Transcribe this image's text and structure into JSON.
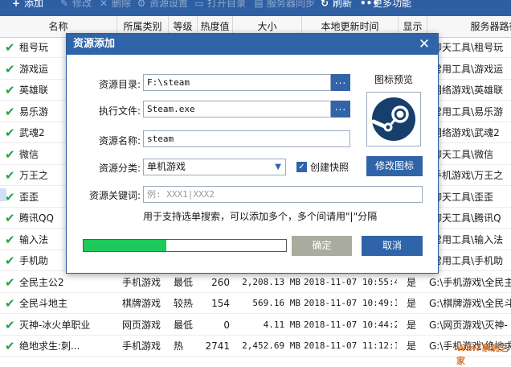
{
  "toolbar": {
    "items": [
      "添加",
      "修改",
      "删除",
      "资源设置",
      "打开目录",
      "服务器同步",
      "刷新",
      "更多功能"
    ]
  },
  "table": {
    "columns": [
      "名称",
      "所属类别",
      "等级",
      "热度值",
      "大小",
      "本地更新时间",
      "显示",
      "服务器路径"
    ],
    "rows": [
      {
        "name": "租号玩",
        "category": "",
        "level": "",
        "heat": "",
        "size": "",
        "time": "",
        "show": "",
        "path": "\\聊天工具\\租号玩"
      },
      {
        "name": "游戏运",
        "category": "",
        "level": "",
        "heat": "",
        "size": "",
        "time": "",
        "show": "",
        "path": "\\常用工具\\游戏运"
      },
      {
        "name": "英雄联",
        "category": "",
        "level": "",
        "heat": "",
        "size": "",
        "time": "",
        "show": "",
        "path": "\\网络游戏\\英雄联"
      },
      {
        "name": "易乐游",
        "category": "",
        "level": "",
        "heat": "",
        "size": "",
        "time": "",
        "show": "",
        "path": "\\常用工具\\易乐游"
      },
      {
        "name": "武魂2",
        "category": "",
        "level": "",
        "heat": "",
        "size": "",
        "time": "",
        "show": "",
        "path": "\\网络游戏\\武魂2"
      },
      {
        "name": "微信",
        "category": "",
        "level": "",
        "heat": "",
        "size": "",
        "time": "",
        "show": "",
        "path": "\\聊天工具\\微信"
      },
      {
        "name": "万王之",
        "category": "",
        "level": "",
        "heat": "",
        "size": "",
        "time": "",
        "show": "",
        "path": "\\手机游戏\\万王之"
      },
      {
        "name": "歪歪",
        "category": "",
        "level": "",
        "heat": "",
        "size": "",
        "time": "",
        "show": "",
        "path": "\\聊天工具\\歪歪"
      },
      {
        "name": "腾讯QQ",
        "category": "",
        "level": "",
        "heat": "",
        "size": "",
        "time": "",
        "show": "",
        "path": "\\聊天工具\\腾讯Q"
      },
      {
        "name": "输入法",
        "category": "",
        "level": "",
        "heat": "",
        "size": "",
        "time": "",
        "show": "",
        "path": "\\常用工具\\输入法"
      },
      {
        "name": "手机助",
        "category": "",
        "level": "",
        "heat": "",
        "size": "",
        "time": "",
        "show": "",
        "path": "\\常用工具\\手机助"
      },
      {
        "name": "全民主公2",
        "category": "手机游戏",
        "level": "最低",
        "heat": "260",
        "size": "2,208.13 MB",
        "time": "2018-11-07 10:55:45",
        "show": "是",
        "path": "G:\\手机游戏\\全民主"
      },
      {
        "name": "全民斗地主",
        "category": "棋牌游戏",
        "level": "较热",
        "heat": "154",
        "size": "569.16 MB",
        "time": "2018-11-07 10:49:17",
        "show": "是",
        "path": "G:\\棋牌游戏\\全民斗"
      },
      {
        "name": "灭神-冰火单职业",
        "category": "网页游戏",
        "level": "最低",
        "heat": "0",
        "size": "4.11 MB",
        "time": "2018-11-07 10:44:27",
        "show": "是",
        "path": "G:\\网页游戏\\灭神-"
      },
      {
        "name": "绝地求生:刺...",
        "category": "手机游戏",
        "level": "热",
        "heat": "2741",
        "size": "2,452.69 MB",
        "time": "2018-11-07 11:12:16",
        "show": "是",
        "path": "G:\\手机游戏\\绝地求"
      }
    ]
  },
  "dialog": {
    "title": "资源添加",
    "dir_label": "资源目录:",
    "dir_value": "F:\\steam",
    "exe_label": "执行文件:",
    "exe_value": "Steam.exe",
    "browse_label": "...",
    "name_label": "资源名称:",
    "name_value": "steam",
    "category_label": "资源分类:",
    "category_value": "单机游戏",
    "shortcut_label": "创建快照",
    "keyword_label": "资源关键词:",
    "keyword_placeholder": "例: XXX1|XXX2",
    "hint": "用于支持选单搜索，可以添加多个，多个间请用\"|\"分隔",
    "preview_label": "图标预览",
    "change_icon_label": "修改图标",
    "ok_label": "确定",
    "cancel_label": "取消",
    "progress_fraction": 0.41,
    "colors": {
      "accent": "#2f64a8",
      "progress": "#1ec95b",
      "check": "#21a547"
    }
  },
  "watermark": "Win7系统之家"
}
